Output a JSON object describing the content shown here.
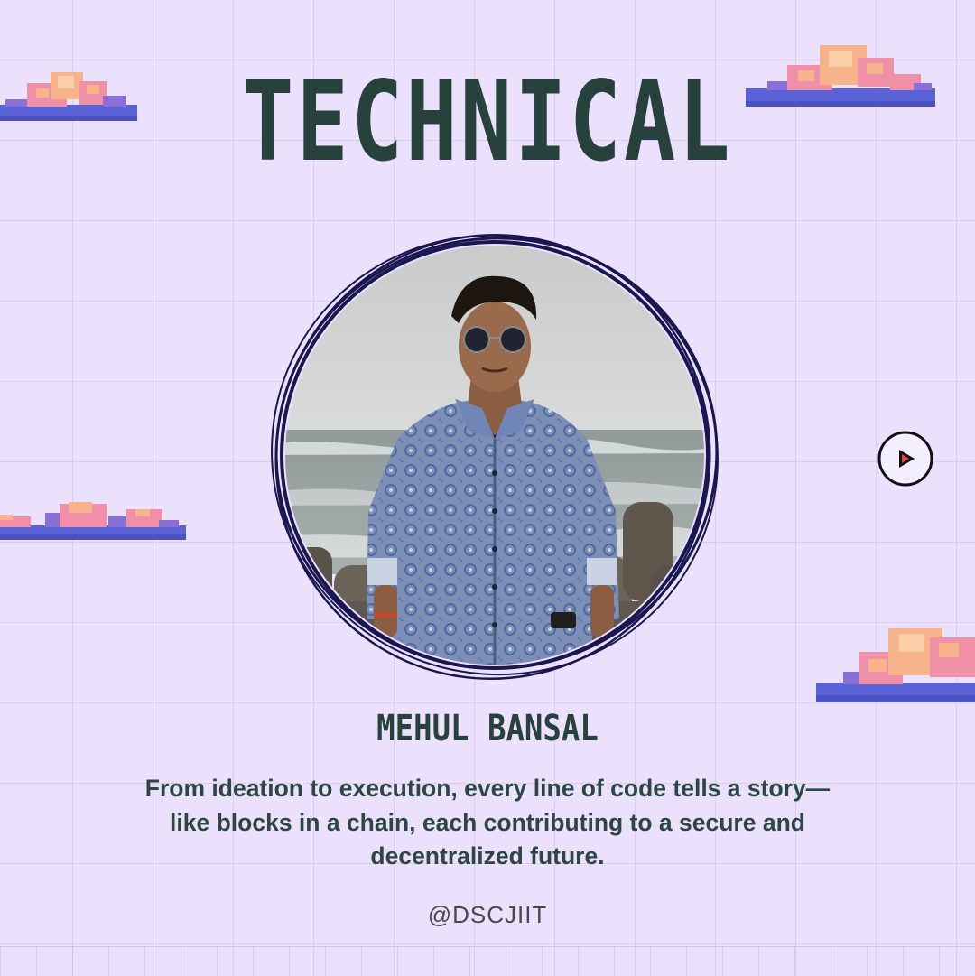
{
  "header": {
    "title": "TECHNICAL"
  },
  "member": {
    "name": "MEHUL BANSAL",
    "photo_alt": "Mehul Bansal"
  },
  "quote": {
    "text": "From ideation to execution, every line of code tells a story—like blocks in a chain, each contributing to a secure and decentralized future."
  },
  "footer": {
    "handle": "@DSCJIIT"
  },
  "navigation": {
    "next_icon": "play-icon"
  },
  "colors": {
    "background": "#ece1fc",
    "grid_line": "#cdbeeb",
    "heading_text": "#27413d",
    "body_text": "#2c4742",
    "frame_ink": "#1a1650",
    "cloud_pink": "#ef8fa8",
    "cloud_peach": "#f7b48b",
    "cloud_blue": "#5a62d6",
    "cloud_violet": "#8a6fd8"
  }
}
